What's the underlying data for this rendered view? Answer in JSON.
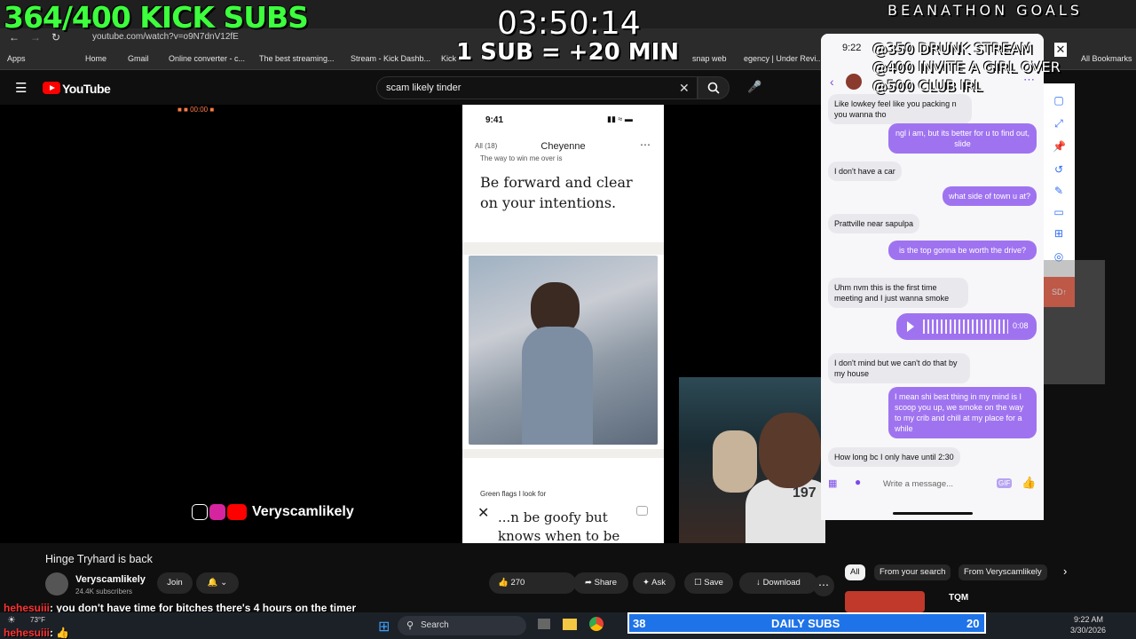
{
  "overlay": {
    "kick_subs": "364/400 KICK SUBS",
    "timer": "03:50:14",
    "sub_rule": "1 SUB = +20 MIN",
    "goals_title": "BEANATHON GOALS",
    "goals": [
      "@350 DRUNK STREAM",
      "@400 INVITE A GIRL OVER",
      "@500 CLUB IRL"
    ]
  },
  "browser": {
    "url": "youtube.com/watch?v=o9N7dnV12fE",
    "bookmarks": [
      "Apps",
      "Home",
      "Gmail",
      "Online converter - c...",
      "The best streaming...",
      "Stream - Kick Dashb...",
      "Kick",
      "snap web",
      "egency | Under Revi...",
      "All Bookmarks"
    ]
  },
  "youtube": {
    "logo": "YouTube",
    "search_value": "scam likely tinder",
    "video_title": "Hinge Tryhard is back",
    "channel_name": "Veryscamlikely",
    "subscribers": "24.4K subscribers",
    "join_label": "Join",
    "like_count": "270",
    "share_label": "Share",
    "ask_label": "Ask",
    "save_label": "Save",
    "download_label": "Download",
    "chips": [
      "All",
      "From your search",
      "From Veryscamlikely"
    ],
    "rec_title": "TQM",
    "watermark": "Veryscamlikely"
  },
  "phone": {
    "time": "9:41",
    "all_count": "All (18)",
    "profile_name": "Cheyenne",
    "cut_prompt": "The way to win me over is",
    "prompt_answer": "Be forward and clear on your intentions.",
    "green_flags_label": "Green flags I look for",
    "green_flags_answer": "...n be goofy but knows when to be"
  },
  "dm": {
    "time": "9:22",
    "messages": [
      {
        "from": "them",
        "text": "Like lowkey feel like you packing n you wanna tho"
      },
      {
        "from": "me",
        "text": "ngl i am, but its better for u to find out, slide"
      },
      {
        "from": "them",
        "text": "I don't have a car"
      },
      {
        "from": "me",
        "text": "what side of town u at?"
      },
      {
        "from": "them",
        "text": "Prattville near sapulpa"
      },
      {
        "from": "me",
        "text": "is the top gonna be worth the drive?"
      },
      {
        "from": "them",
        "text": "Uhm nvm this is the first time meeting and I just wanna smoke"
      },
      {
        "from": "them",
        "text": "I don't mind but we can't do that by my house"
      },
      {
        "from": "me",
        "text": "I mean shi best thing in my mind is I scoop you up, we smoke on the way to my crib and chill at my place for a while"
      },
      {
        "from": "them",
        "text": "How long bc I only have until 2:30"
      }
    ],
    "voice_duration": "0:08",
    "compose_placeholder": "Write a message..."
  },
  "chat": [
    {
      "user": "hehesuiii",
      "text": ": you don't have time for bitches there's 4 hours on the timer"
    },
    {
      "user": "hehesuiii",
      "text": ": 👍"
    }
  ],
  "daily_subs": {
    "left": "38",
    "label": "DAILY SUBS",
    "right": "20"
  },
  "taskbar": {
    "search": "Search",
    "weather": "73°F",
    "clock_time": "9:22 AM",
    "clock_date": "3/30/2026"
  }
}
